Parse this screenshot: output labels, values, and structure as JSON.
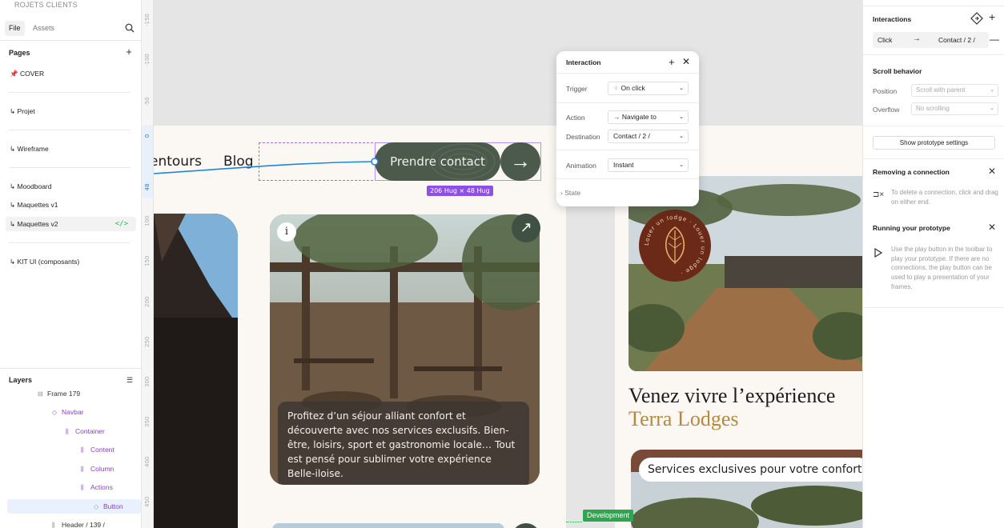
{
  "left_panel": {
    "project_title": "ROJETS CLIENTS",
    "tabs": {
      "file": "File",
      "assets": "Assets"
    },
    "pages_header": "Pages",
    "pages": [
      {
        "label": "📌 COVER"
      },
      {
        "label": "↳ Projet"
      },
      {
        "label": "↳ Wireframe"
      },
      {
        "label": "↳ Moodboard"
      },
      {
        "label": "↳ Maquettes v1"
      },
      {
        "label": "↳ Maquettes v2"
      },
      {
        "label": "↳ KIT UI (composants)"
      }
    ],
    "dev_icon": "</>",
    "layers_header": "Layers",
    "layers": [
      {
        "label": "Frame 179"
      },
      {
        "label": "Navbar"
      },
      {
        "label": "Container"
      },
      {
        "label": "Content"
      },
      {
        "label": "Column"
      },
      {
        "label": "Actions"
      },
      {
        "label": "Button"
      },
      {
        "label": "Header / 139 /"
      }
    ]
  },
  "ruler": {
    "ticks": [
      "-150",
      "-100",
      "-50",
      "0",
      "48",
      "100",
      "150",
      "200",
      "250",
      "300",
      "350",
      "400",
      "450"
    ]
  },
  "canvas": {
    "nav_links": {
      "tours": "entours",
      "blog": "Blog"
    },
    "cta_label": "Prendre contact",
    "cta_arrow": "→",
    "size_badge": "206 Hug × 48 Hug",
    "card_info": "i",
    "card_arrow": "↗",
    "card_text": "Profitez d’un séjour alliant confort et découverte avec nos services exclusifs. Bien-être, loisirs, sport et gastronomie locale… Tout est pensé pour sublimer votre expérience Belle-iloise.",
    "headline_line1": "Venez vivre l’expérience",
    "headline_line2": "Terra Lodges",
    "services_pill": "Services exclusives pour votre confort",
    "dev_badge": "Development",
    "logo_ring_text": "Louer un lodge · Louer un lodge ·"
  },
  "interaction_popup": {
    "title": "Interaction",
    "trigger_label": "Trigger",
    "trigger_value": "On click",
    "action_label": "Action",
    "action_value": "Navigate to",
    "destination_label": "Destination",
    "destination_value": "Contact / 2 /",
    "animation_label": "Animation",
    "animation_value": "Instant",
    "state_label": "State"
  },
  "right_panel": {
    "interactions_header": "Interactions",
    "click_label": "Click",
    "click_target": "Contact / 2 /",
    "scroll_header": "Scroll behavior",
    "position_label": "Position",
    "position_value": "Scroll with parent",
    "overflow_label": "Overflow",
    "overflow_value": "No scrolling",
    "show_settings": "Show prototype settings",
    "removing_header": "Removing a connection",
    "removing_text": "To delete a connection, click and drag on either end.",
    "running_header": "Running your prototype",
    "running_text": "Use the play button in the toolbar to play your prototype. If there are no connections, the play button can be used to play a presentation of your frames."
  },
  "colors": {
    "cta_green": "#4c5a4c",
    "accent_gold": "#b8873a",
    "selection_purple": "#8e4ee8",
    "connection_blue": "#1f86e0",
    "dev_green": "#2da74f",
    "logo_brown": "#6b2a18"
  }
}
